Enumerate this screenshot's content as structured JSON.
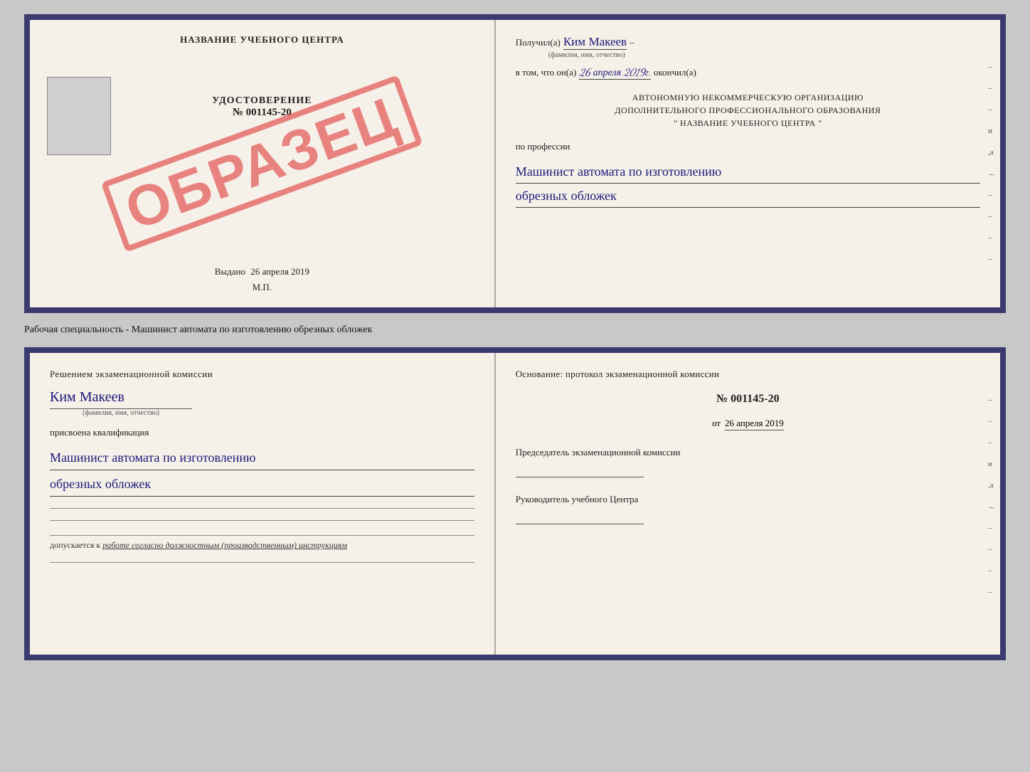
{
  "top_left": {
    "school_name": "НАЗВАНИЕ УЧЕБНОГО ЦЕНТРА",
    "udostoverenie": "УДОСТОВЕРЕНИЕ",
    "number": "№ 001145-20",
    "vydano_label": "Выдано",
    "vydano_date": "26 апреля 2019",
    "mp_label": "М.П.",
    "stamp": "ОБРАЗЕЦ"
  },
  "top_right": {
    "poluchil_label": "Получил(a)",
    "recipient_name": "Ким Макеев",
    "fio_sub": "(фамилия, имя, отчество)",
    "vtom_label": "в том, что он(а)",
    "vtom_date": "26 апреля 2019г.",
    "okonchil_label": "окончил(а)",
    "org_line1": "АВТОНОМНУЮ НЕКОММЕРЧЕСКУЮ ОРГАНИЗАЦИЮ",
    "org_line2": "ДОПОЛНИТЕЛЬНОГО ПРОФЕССИОНАЛЬНОГО ОБРАЗОВАНИЯ",
    "org_line3": "\" НАЗВАНИЕ УЧЕБНОГО ЦЕНТРА \"",
    "po_professii": "по профессии",
    "profession_line1": "Машинист автомата по изготовлению",
    "profession_line2": "обрезных обложек",
    "side_marks": [
      "-",
      "-",
      "-",
      "-",
      "и",
      ",а",
      "←",
      "-",
      "-",
      "-",
      "-"
    ]
  },
  "caption": {
    "text": "Рабочая специальность - Машинист автомата по изготовлению обрезных обложек"
  },
  "bottom_left": {
    "resheniyem_label": "Решением экзаменационной комиссии",
    "name": "Ким Макеев",
    "fio_sub": "(фамилия, имя, отчество)",
    "prisvoena_label": "присвоена квалификация",
    "qual_line1": "Машинист автомата по изготовлению",
    "qual_line2": "обрезных обложек",
    "dopuskaetsya_prefix": "допускается к",
    "dopuskaetsya_text": "работе согласно должностным (производственным) инструкциям"
  },
  "bottom_right": {
    "osnovanie_label": "Основание: протокол экзаменационной комиссии",
    "number": "№ 001145-20",
    "ot_label": "от",
    "date": "26 апреля 2019",
    "predsedatel_label": "Председатель экзаменационной комиссии",
    "rukovoditel_label": "Руководитель учебного Центра",
    "side_marks": [
      "-",
      "-",
      "-",
      "и",
      ",а",
      "←",
      "-",
      "-",
      "-",
      "-"
    ]
  }
}
